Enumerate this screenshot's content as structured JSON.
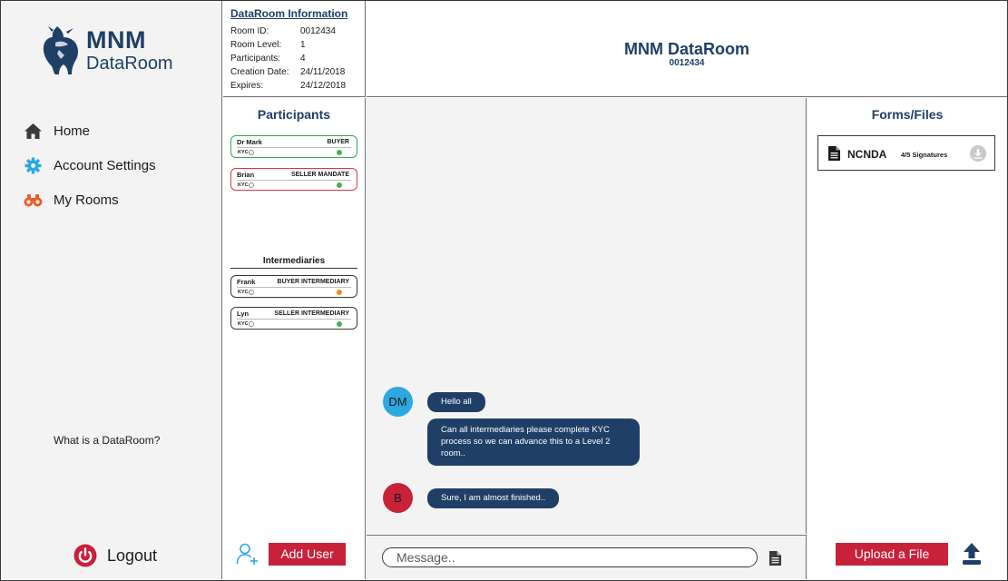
{
  "brand": {
    "name_line1": "MNM",
    "name_line2": "DataRoom"
  },
  "nav": {
    "items": [
      {
        "label": "Home",
        "icon": "home-icon"
      },
      {
        "label": "Account Settings",
        "icon": "gear-icon"
      },
      {
        "label": "My Rooms",
        "icon": "binoculars-icon"
      }
    ],
    "help_link": "What is a DataRoom?",
    "logout_label": "Logout"
  },
  "info": {
    "title": "DataRoom Information",
    "rows": [
      {
        "key": "Room ID:",
        "value": "0012434"
      },
      {
        "key": "Room Level:",
        "value": "1"
      },
      {
        "key": "Participants:",
        "value": "4"
      },
      {
        "key": "Creation Date:",
        "value": "24/11/2018"
      },
      {
        "key": "Expires:",
        "value": "24/12/2018"
      }
    ]
  },
  "room": {
    "title": "MNM DataRoom",
    "id": "0012434"
  },
  "participants": {
    "title": "Participants",
    "members": [
      {
        "name": "Dr Mark",
        "role": "BUYER",
        "kyc": "KYC",
        "border": "#3aa15a",
        "status_color": "#4caf50"
      },
      {
        "name": "Brian",
        "role": "SELLER MANDATE",
        "kyc": "KYC",
        "border": "#d9364a",
        "status_color": "#4caf50"
      }
    ],
    "intermediaries_title": "Intermediaries",
    "intermediaries": [
      {
        "name": "Frank",
        "role": "BUYER INTERMEDIARY",
        "kyc": "KYC",
        "status_color": "#f08a24"
      },
      {
        "name": "Lyn",
        "role": "SELLER INTERMEDIARY",
        "kyc": "KYC",
        "status_color": "#4caf50"
      }
    ],
    "add_user_label": "Add User"
  },
  "chat": {
    "messages": [
      {
        "initials": "DM",
        "avatar_color": "#2fa8e0",
        "texts": [
          "Hello all",
          "Can  all intermediaries please complete KYC process so we can advance this to a Level 2 room.."
        ]
      },
      {
        "initials": "B",
        "avatar_color": "#c8213a",
        "texts": [
          "Sure, I am almost finished.."
        ]
      }
    ],
    "input_placeholder": "Message.."
  },
  "files": {
    "title": "Forms/Files",
    "items": [
      {
        "name": "NCNDA",
        "signatures": "4/5 Signatures"
      }
    ],
    "upload_label": "Upload a File"
  },
  "colors": {
    "brand_navy": "#1f3f66",
    "accent_red": "#c8213a",
    "chat_blue": "#2fa8e0"
  }
}
